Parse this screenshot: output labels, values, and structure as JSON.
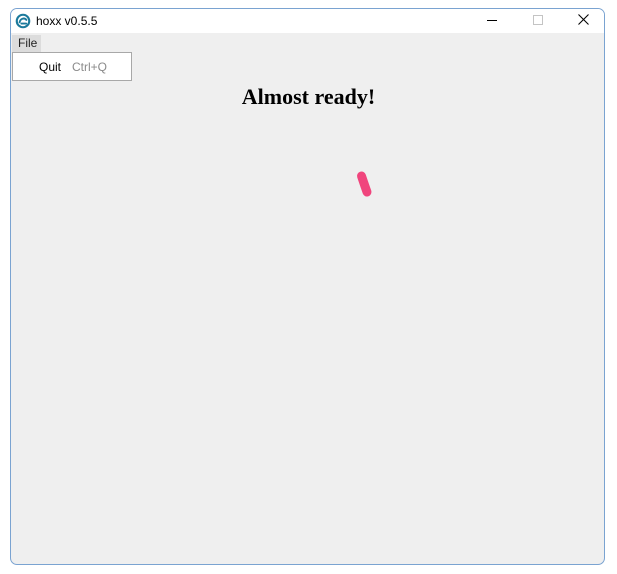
{
  "window": {
    "title": "hoxx v0.5.5",
    "icon": "hoxx-app-icon",
    "controls": [
      "minimize-icon",
      "maximize-icon",
      "close-icon"
    ]
  },
  "menubar": {
    "file_label": "File"
  },
  "file_menu": {
    "items": [
      {
        "label": "Quit",
        "shortcut": "Ctrl+Q"
      }
    ]
  },
  "main": {
    "heading": "Almost ready!",
    "loader_icon": "spinner-icon"
  },
  "colors": {
    "window_border": "#7aa3d1",
    "background": "#efefef",
    "spinner": "#f0457d",
    "app_icon": "#1c7a9c"
  }
}
